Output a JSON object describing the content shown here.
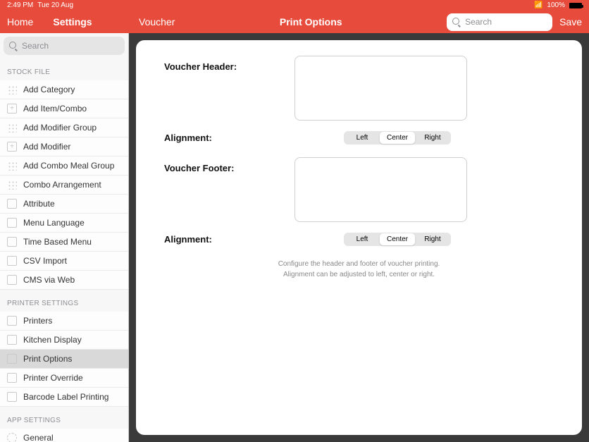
{
  "status": {
    "time": "2:49 PM",
    "date": "Tue 20 Aug",
    "battery": "100%"
  },
  "headerLeft": {
    "home": "Home",
    "settings": "Settings"
  },
  "headerRight": {
    "voucher": "Voucher",
    "title": "Print Options",
    "searchPlaceholder": "Search",
    "save": "Save"
  },
  "sidebar": {
    "searchPlaceholder": "Search",
    "sections": [
      {
        "title": "STOCK FILE",
        "items": [
          {
            "label": "Add Category",
            "icon": "grid"
          },
          {
            "label": "Add Item/Combo",
            "icon": "plus"
          },
          {
            "label": "Add Modifier Group",
            "icon": "grid"
          },
          {
            "label": "Add Modifier",
            "icon": "plus"
          },
          {
            "label": "Add Combo Meal Group",
            "icon": "grid"
          },
          {
            "label": "Combo Arrangement",
            "icon": "grid"
          },
          {
            "label": "Attribute",
            "icon": "simple"
          },
          {
            "label": "Menu Language",
            "icon": "simple"
          },
          {
            "label": "Time Based Menu",
            "icon": "simple"
          },
          {
            "label": "CSV Import",
            "icon": "simple"
          },
          {
            "label": "CMS via Web",
            "icon": "simple"
          }
        ]
      },
      {
        "title": "PRINTER SETTINGS",
        "items": [
          {
            "label": "Printers",
            "icon": "simple"
          },
          {
            "label": "Kitchen Display",
            "icon": "simple"
          },
          {
            "label": "Print Options",
            "icon": "simple",
            "selected": true
          },
          {
            "label": "Printer Override",
            "icon": "simple"
          },
          {
            "label": "Barcode Label Printing",
            "icon": "simple"
          }
        ]
      },
      {
        "title": "APP SETTINGS",
        "items": [
          {
            "label": "General",
            "icon": "gear"
          }
        ]
      }
    ]
  },
  "form": {
    "headerLabel": "Voucher Header:",
    "footerLabel": "Voucher Footer:",
    "alignLabel": "Alignment:",
    "headerValue": "",
    "footerValue": "",
    "segments": [
      "Left",
      "Center",
      "Right"
    ],
    "activeSegment": "Center",
    "hint1": "Configure the header and footer of voucher printing.",
    "hint2": "Alignment can be adjusted to left, center or right."
  }
}
